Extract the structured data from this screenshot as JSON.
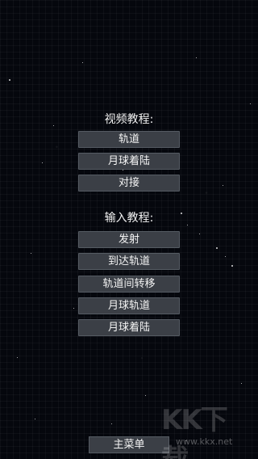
{
  "sections": {
    "video_tutorial_title": "视频教程:",
    "input_tutorial_title": "输入教程:"
  },
  "video_buttons": [
    "轨道",
    "月球着陆",
    "对接"
  ],
  "input_buttons": [
    "发射",
    "到达轨道",
    "轨道间转移",
    "月球轨道",
    "月球着陆"
  ],
  "footer": {
    "main_menu": "主菜单"
  },
  "watermark": {
    "logo": "KK下载",
    "site": "www.kkx.net"
  },
  "colors": {
    "background": "#05070d",
    "button": "#3b3f46",
    "text": "#f4f4f4"
  }
}
